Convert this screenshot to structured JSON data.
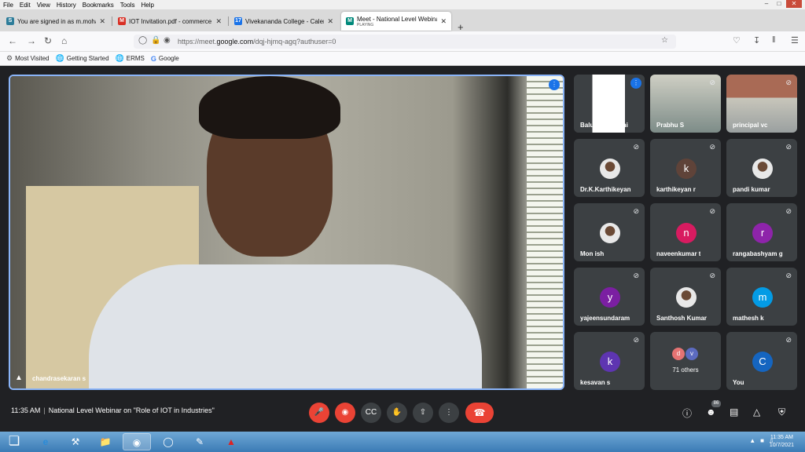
{
  "menubar": {
    "items": [
      {
        "label": "File"
      },
      {
        "label": "Edit"
      },
      {
        "label": "View"
      },
      {
        "label": "History"
      },
      {
        "label": "Bookmarks"
      },
      {
        "label": "Tools"
      },
      {
        "label": "Help"
      }
    ]
  },
  "tabs": [
    {
      "label": "You are signed in as m.mohan",
      "favicon": "S",
      "color": "#2e7d9a"
    },
    {
      "label": "IOT Invitation.pdf - commerce",
      "favicon": "M",
      "color": "#d93025"
    },
    {
      "label": "Vivekananda College - Calendar",
      "favicon": "17",
      "color": "#1a73e8"
    },
    {
      "label": "Meet - National Level Webinar",
      "favicon": "M",
      "color": "#00897b",
      "sublabel": "PLAYING"
    }
  ],
  "urlbar": {
    "url_prefix": "https://meet.",
    "url_domain": "google.com",
    "url_suffix": "/dqj-hjmq-agq?authuser=0"
  },
  "bookmarks": [
    {
      "label": "Most Visited",
      "icon": "gear-icon"
    },
    {
      "label": "Getting Started",
      "icon": "globe-icon"
    },
    {
      "label": "ERMS",
      "icon": "globe-icon"
    },
    {
      "label": "Google",
      "icon": "google-icon"
    }
  ],
  "main_speaker": {
    "name": "chandrasekaran s"
  },
  "participants": [
    {
      "name": "Balu Subramani",
      "avatar": "",
      "type": "video"
    },
    {
      "name": "Prabhu S",
      "avatar": "",
      "type": "video"
    },
    {
      "name": "principal vc",
      "avatar": "",
      "type": "video"
    },
    {
      "name": "Dr.K.Karthikeyan",
      "avatar": "",
      "type": "photo"
    },
    {
      "name": "karthikeyan r",
      "avatar": "k",
      "color": "#5f4339",
      "type": "letter"
    },
    {
      "name": "pandi kumar",
      "avatar": "",
      "type": "photo"
    },
    {
      "name": "Mon ish",
      "avatar": "",
      "type": "photo"
    },
    {
      "name": "naveenkumar t",
      "avatar": "n",
      "color": "#d81b60",
      "type": "letter"
    },
    {
      "name": "rangabashyam g",
      "avatar": "r",
      "color": "#8e24aa",
      "type": "letter"
    },
    {
      "name": "yajeensundaram",
      "avatar": "y",
      "color": "#7b1fa2",
      "type": "letter"
    },
    {
      "name": "Santhosh Kumar",
      "avatar": "",
      "type": "photo"
    },
    {
      "name": "mathesh k",
      "avatar": "m",
      "color": "#039be5",
      "type": "letter"
    },
    {
      "name": "kesavan s",
      "avatar": "k",
      "color": "#5e35b1",
      "type": "letter"
    },
    {
      "name": "71 others",
      "avatar": "",
      "type": "others",
      "mini": [
        "d",
        "v"
      ]
    },
    {
      "name": "You",
      "avatar": "C",
      "color": "#1565c0",
      "type": "letter"
    }
  ],
  "controls": {
    "time": "11:35 AM",
    "meeting_title": "National Level Webinar on \"Role of IOT in Industries\"",
    "participant_count": "86"
  },
  "taskbar": {
    "time": "11:35 AM",
    "date": "10/7/2021"
  }
}
